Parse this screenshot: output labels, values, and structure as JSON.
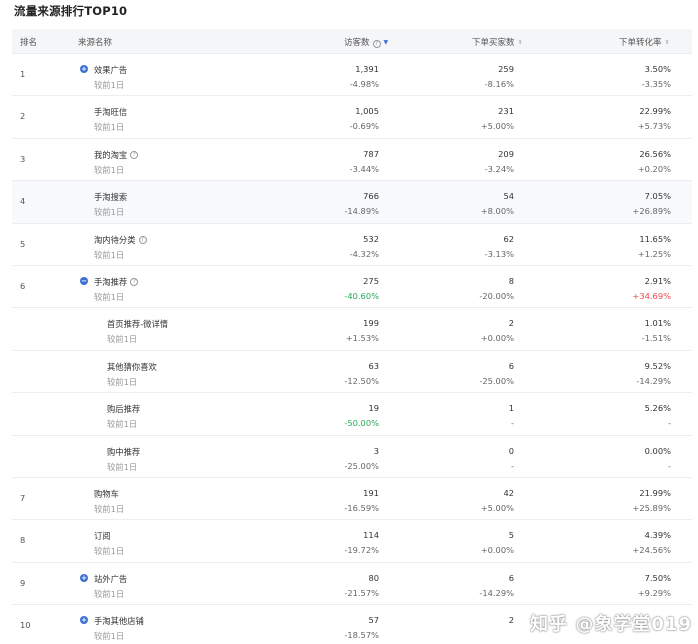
{
  "title": "流量来源排行TOP10",
  "header": {
    "rank": "排名",
    "source": "来源名称",
    "visitors": "访客数",
    "buyers": "下单买家数",
    "conversion": "下单转化率"
  },
  "compare_label": "较前1日",
  "rows": [
    {
      "rank": "1",
      "name": "效果广告",
      "toggle": "+",
      "help": false,
      "visitors": "1,391",
      "visitors_change": "-4.98%",
      "buyers": "259",
      "buyers_change": "-8.16%",
      "conversion": "3.50%",
      "conversion_change": "-3.35%"
    },
    {
      "rank": "2",
      "name": "手淘旺信",
      "toggle": "",
      "help": false,
      "visitors": "1,005",
      "visitors_change": "-0.69%",
      "buyers": "231",
      "buyers_change": "+5.00%",
      "conversion": "22.99%",
      "conversion_change": "+5.73%"
    },
    {
      "rank": "3",
      "name": "我的淘宝",
      "toggle": "",
      "help": true,
      "visitors": "787",
      "visitors_change": "-3.44%",
      "buyers": "209",
      "buyers_change": "-3.24%",
      "conversion": "26.56%",
      "conversion_change": "+0.20%"
    },
    {
      "rank": "4",
      "name": "手淘搜索",
      "toggle": "",
      "help": false,
      "visitors": "766",
      "visitors_change": "-14.89%",
      "buyers": "54",
      "buyers_change": "+8.00%",
      "conversion": "7.05%",
      "conversion_change": "+26.89%"
    },
    {
      "rank": "5",
      "name": "淘内待分类",
      "toggle": "",
      "help": true,
      "visitors": "532",
      "visitors_change": "-4.32%",
      "buyers": "62",
      "buyers_change": "-3.13%",
      "conversion": "11.65%",
      "conversion_change": "+1.25%"
    },
    {
      "rank": "6",
      "name": "手淘推荐",
      "toggle": "−",
      "help": true,
      "visitors": "275",
      "visitors_change": "-40.60%",
      "buyers": "8",
      "buyers_change": "-20.00%",
      "conversion": "2.91%",
      "conversion_change": "+34.69%"
    },
    {
      "rank": "",
      "name": "首页推荐-微详情",
      "toggle": "",
      "help": false,
      "visitors": "199",
      "visitors_change": "+1.53%",
      "buyers": "2",
      "buyers_change": "+0.00%",
      "conversion": "1.01%",
      "conversion_change": "-1.51%"
    },
    {
      "rank": "",
      "name": "其他猜你喜欢",
      "toggle": "",
      "help": false,
      "visitors": "63",
      "visitors_change": "-12.50%",
      "buyers": "6",
      "buyers_change": "-25.00%",
      "conversion": "9.52%",
      "conversion_change": "-14.29%"
    },
    {
      "rank": "",
      "name": "购后推荐",
      "toggle": "",
      "help": false,
      "visitors": "19",
      "visitors_change": "-50.00%",
      "buyers": "1",
      "buyers_change": "-",
      "conversion": "5.26%",
      "conversion_change": "-"
    },
    {
      "rank": "",
      "name": "购中推荐",
      "toggle": "",
      "help": false,
      "visitors": "3",
      "visitors_change": "-25.00%",
      "buyers": "0",
      "buyers_change": "-",
      "conversion": "0.00%",
      "conversion_change": "-"
    },
    {
      "rank": "7",
      "name": "购物车",
      "toggle": "",
      "help": false,
      "visitors": "191",
      "visitors_change": "-16.59%",
      "buyers": "42",
      "buyers_change": "+5.00%",
      "conversion": "21.99%",
      "conversion_change": "+25.89%"
    },
    {
      "rank": "8",
      "name": "订阅",
      "toggle": "",
      "help": false,
      "visitors": "114",
      "visitors_change": "-19.72%",
      "buyers": "5",
      "buyers_change": "+0.00%",
      "conversion": "4.39%",
      "conversion_change": "+24.56%"
    },
    {
      "rank": "9",
      "name": "站外广告",
      "toggle": "+",
      "help": false,
      "visitors": "80",
      "visitors_change": "-21.57%",
      "buyers": "6",
      "buyers_change": "-14.29%",
      "conversion": "7.50%",
      "conversion_change": "+9.29%"
    },
    {
      "rank": "10",
      "name": "手淘其他店铺",
      "toggle": "+",
      "help": false,
      "visitors": "57",
      "visitors_change": "-18.57%",
      "buyers": "2",
      "buyers_change": "",
      "conversion": "",
      "conversion_change": ""
    }
  ],
  "watermark": "知乎 @象学堂019",
  "colors": {
    "accent": "#3b6fd6",
    "positive_highlight": "#2aa95a",
    "negative_highlight": "#f0484f"
  }
}
